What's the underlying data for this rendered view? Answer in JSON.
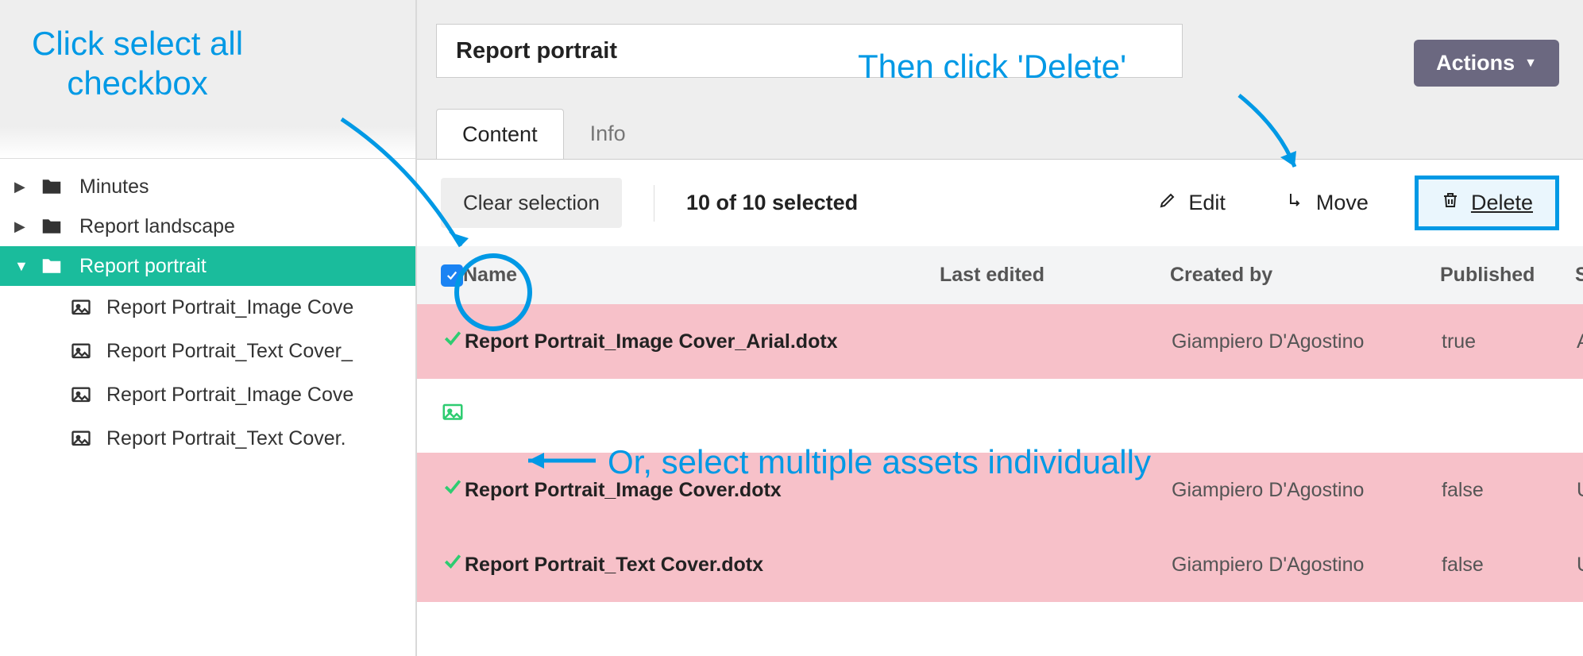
{
  "annotations": {
    "select_all": "Click select all\ncheckbox",
    "then_delete": "Then click 'Delete'",
    "or_individual": "Or, select multiple assets individually"
  },
  "sidebar": {
    "items": [
      {
        "label": "Minutes",
        "expanded": false,
        "active": false
      },
      {
        "label": "Report landscape",
        "expanded": false,
        "active": false
      },
      {
        "label": "Report portrait",
        "expanded": true,
        "active": true
      }
    ],
    "children": [
      {
        "label": "Report Portrait_Image Cove"
      },
      {
        "label": "Report Portrait_Text Cover_"
      },
      {
        "label": "Report Portrait_Image Cove"
      },
      {
        "label": "Report Portrait_Text Cover."
      }
    ]
  },
  "header": {
    "title": "Report portrait",
    "actions_label": "Actions"
  },
  "tabs": [
    {
      "label": "Content",
      "active": true
    },
    {
      "label": "Info",
      "active": false
    }
  ],
  "toolbar": {
    "clear": "Clear selection",
    "selection": "10 of 10 selected",
    "edit": "Edit",
    "move": "Move",
    "delete": "Delete"
  },
  "columns": {
    "name": "Name",
    "last_edited": "Last edited",
    "created_by": "Created by",
    "published": "Published",
    "status": "Status"
  },
  "rows": [
    {
      "selected": true,
      "icon": "check",
      "name": "Report Portrait_Image Cover_Arial.dotx",
      "last_edited": "",
      "created_by": "Giampiero D'Agostino",
      "published": "true",
      "status": "Archived"
    },
    {
      "selected": false,
      "icon": "image",
      "name": "",
      "last_edited": "",
      "created_by": "",
      "published": "",
      "status": ""
    },
    {
      "selected": true,
      "icon": "check",
      "name": "Report Portrait_Image Cover.dotx",
      "last_edited": "",
      "created_by": "Giampiero D'Agostino",
      "published": "false",
      "status": "Unpublished"
    },
    {
      "selected": true,
      "icon": "check",
      "name": "Report Portrait_Text Cover.dotx",
      "last_edited": "",
      "created_by": "Giampiero D'Agostino",
      "published": "false",
      "status": "Unpublished"
    }
  ]
}
